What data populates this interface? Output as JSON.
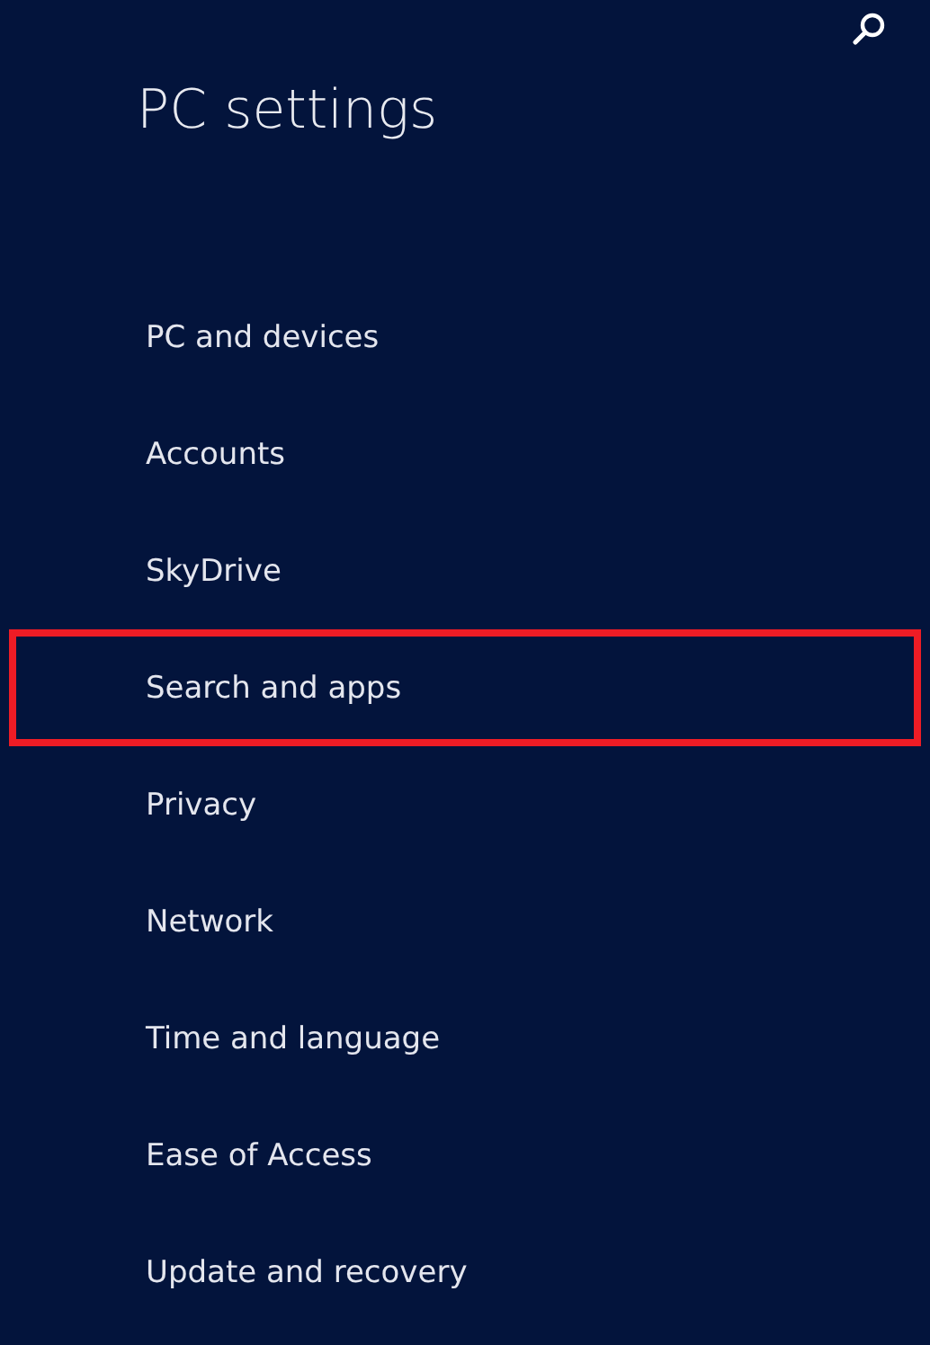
{
  "header": {
    "title": "PC settings"
  },
  "items": [
    {
      "label": "PC and devices",
      "highlighted": false
    },
    {
      "label": "Accounts",
      "highlighted": false
    },
    {
      "label": "SkyDrive",
      "highlighted": false
    },
    {
      "label": "Search and apps",
      "highlighted": true
    },
    {
      "label": "Privacy",
      "highlighted": false
    },
    {
      "label": "Network",
      "highlighted": false
    },
    {
      "label": "Time and language",
      "highlighted": false
    },
    {
      "label": "Ease of Access",
      "highlighted": false
    },
    {
      "label": "Update and recovery",
      "highlighted": false
    }
  ]
}
